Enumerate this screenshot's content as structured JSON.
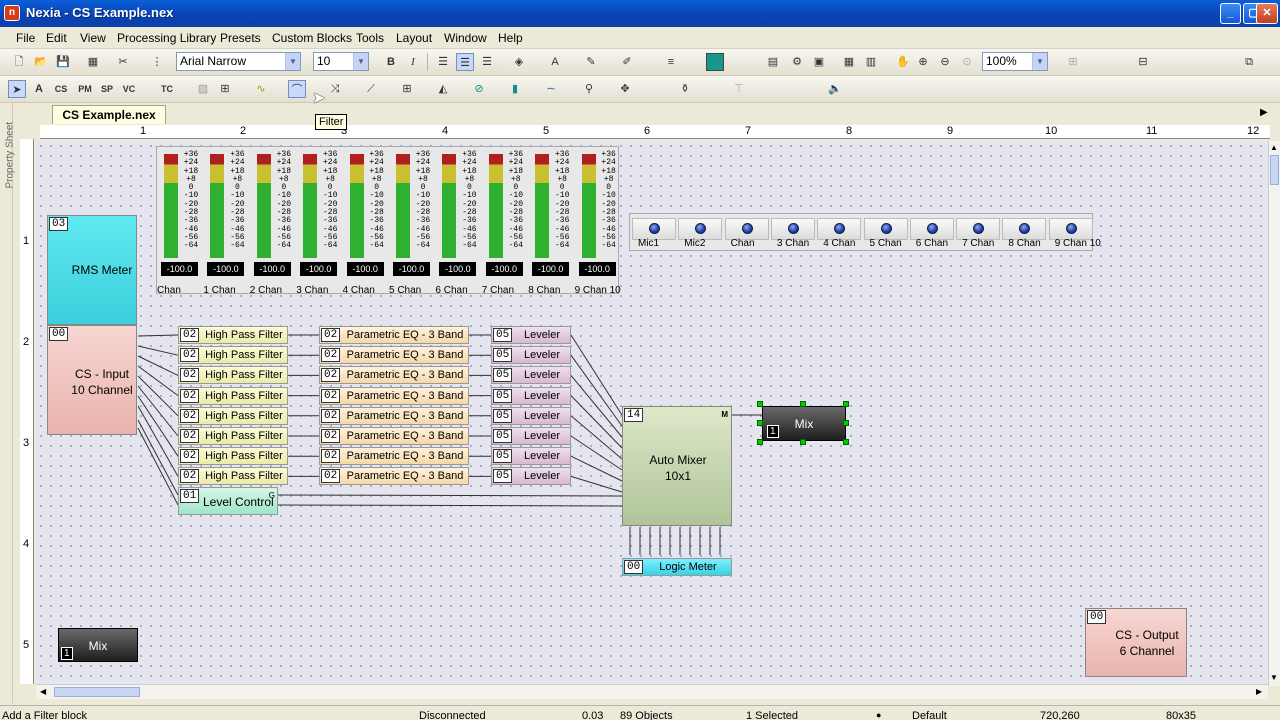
{
  "window": {
    "title": "Nexia - CS Example.nex",
    "app_icon": "n"
  },
  "menu": [
    "File",
    "Edit",
    "View",
    "Processing Library",
    "Presets",
    "Custom Blocks",
    "Tools",
    "Layout",
    "Window",
    "Help"
  ],
  "toolbar": {
    "font_name": "Arial Narrow",
    "font_size": "10",
    "zoom": "100%"
  },
  "toolbar2": {
    "tc_label": "TC",
    "sp_label": "SP",
    "pm_label": "PM",
    "vc_label": "VC",
    "cs_label": "CS"
  },
  "tooltip": "Filter",
  "document_tab": "CS Example.nex",
  "side_panel_label": "Property Sheet",
  "ruler": {
    "h": [
      "1",
      "2",
      "3",
      "4",
      "5",
      "6",
      "7",
      "8",
      "9",
      "10",
      "11",
      "12"
    ],
    "v": [
      "1",
      "2",
      "3",
      "4",
      "5"
    ]
  },
  "meters": {
    "scale": [
      "+36",
      "+24",
      "+18",
      "+8",
      "0",
      "-10",
      "-20",
      "-28",
      "-36",
      "-46",
      "-56",
      "-64"
    ],
    "value": "-100.0",
    "labels": [
      "Chan",
      "1 Chan",
      "2 Chan",
      "3 Chan",
      "4 Chan",
      "5 Chan",
      "6 Chan",
      "7 Chan",
      "8 Chan",
      "9 Chan 10"
    ]
  },
  "leds": {
    "labels": [
      "Mic1",
      "Mic2",
      "Chan",
      "3 Chan",
      "4 Chan",
      "5 Chan",
      "6 Chan",
      "7 Chan",
      "8 Chan",
      "9 Chan 10"
    ]
  },
  "blocks": {
    "rms": {
      "badge": "03",
      "line1": "RMS Meter"
    },
    "input": {
      "badge": "00",
      "line1": "CS - Input",
      "line2": "10 Channel"
    },
    "hpf": {
      "badge": "02",
      "label": "High Pass Filter"
    },
    "peq": {
      "badge": "02",
      "label": "Parametric EQ - 3 Band"
    },
    "lev": {
      "badge": "05",
      "label": "Leveler"
    },
    "levelcontrol": {
      "badge": "01",
      "label": "Level Control",
      "port": "G"
    },
    "automixer": {
      "badge": "14",
      "line1": "Auto Mixer",
      "line2": "10x1",
      "port": "M"
    },
    "logicmeter": {
      "badge": "00",
      "label": "Logic Meter"
    },
    "mix1": {
      "label": "Mix",
      "num": "1"
    },
    "mix2": {
      "label": "Mix",
      "num": "1"
    },
    "output": {
      "badge": "00",
      "line1": "CS - Output",
      "line2": "6 Channel"
    }
  },
  "status": {
    "hint": "Add a Filter block",
    "connection": "Disconnected",
    "version": "0.03",
    "objects": "89 Objects",
    "selected": "1 Selected",
    "preset": "Default",
    "coords": "720,260",
    "size": "80x35"
  }
}
